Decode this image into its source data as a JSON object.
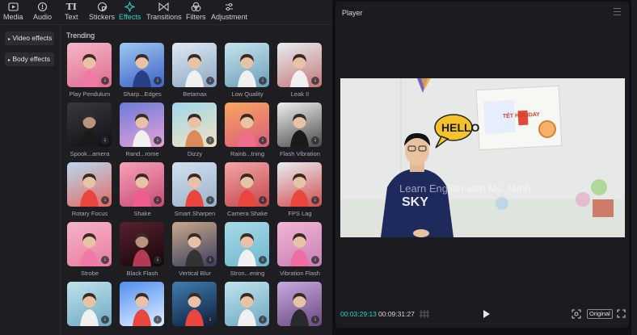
{
  "tabs": [
    {
      "label": "Media",
      "icon": "media-icon"
    },
    {
      "label": "Audio",
      "icon": "audio-icon"
    },
    {
      "label": "Text",
      "icon": "text-icon"
    },
    {
      "label": "Stickers",
      "icon": "stickers-icon"
    },
    {
      "label": "Effects",
      "icon": "effects-icon",
      "active": true
    },
    {
      "label": "Transitions",
      "icon": "transitions-icon"
    },
    {
      "label": "Filters",
      "icon": "filters-icon"
    },
    {
      "label": "Adjustment",
      "icon": "adjustment-icon"
    }
  ],
  "sidebar": {
    "items": [
      {
        "label": "Video effects"
      },
      {
        "label": "Body effects"
      }
    ]
  },
  "section_title": "Trending",
  "effects": [
    {
      "label": "Play Pendulum"
    },
    {
      "label": "Sharp...Edges"
    },
    {
      "label": "Betamax"
    },
    {
      "label": "Low Quality"
    },
    {
      "label": "Leak II"
    },
    {
      "label": "Spook...amera"
    },
    {
      "label": "Rand...rome"
    },
    {
      "label": "Dizzy"
    },
    {
      "label": "Rainb...tning"
    },
    {
      "label": "Flash Vibration"
    },
    {
      "label": "Rotary Focus"
    },
    {
      "label": "Shake"
    },
    {
      "label": "Smart Sharpen"
    },
    {
      "label": "Camera Shake"
    },
    {
      "label": "FPS Lag"
    },
    {
      "label": "Strobe"
    },
    {
      "label": "Black Flash"
    },
    {
      "label": "Vertical Blur"
    },
    {
      "label": "Stron...ening"
    },
    {
      "label": "Vibration Flash"
    },
    {
      "label": ""
    },
    {
      "label": ""
    },
    {
      "label": ""
    },
    {
      "label": ""
    },
    {
      "label": ""
    }
  ],
  "player": {
    "title": "Player",
    "current_time": "00:03:29:13",
    "total_time": "00:09:31:27",
    "original_label": "Original",
    "video": {
      "watermark": "Learn English with Ms. Minh",
      "speech_bubble": "HELLO",
      "poster_title": "TẾT HOLIDAY"
    }
  }
}
